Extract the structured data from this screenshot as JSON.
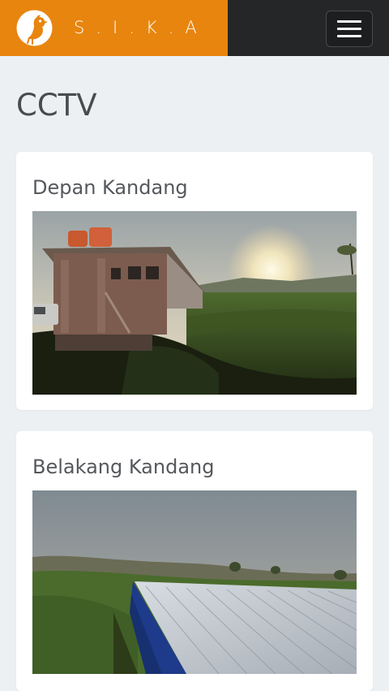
{
  "brand": {
    "name": "S.I.K.A",
    "accent_color": "#e8850f",
    "logo_icon": "chicken-logo-icon"
  },
  "navbar": {
    "background": "#252627",
    "menu_icon": "hamburger-menu-icon"
  },
  "page": {
    "title": "CCTV"
  },
  "cameras": [
    {
      "title": "Depan Kandang",
      "image_icon": "camera-feed-front"
    },
    {
      "title": "Belakang Kandang",
      "image_icon": "camera-feed-back"
    }
  ]
}
